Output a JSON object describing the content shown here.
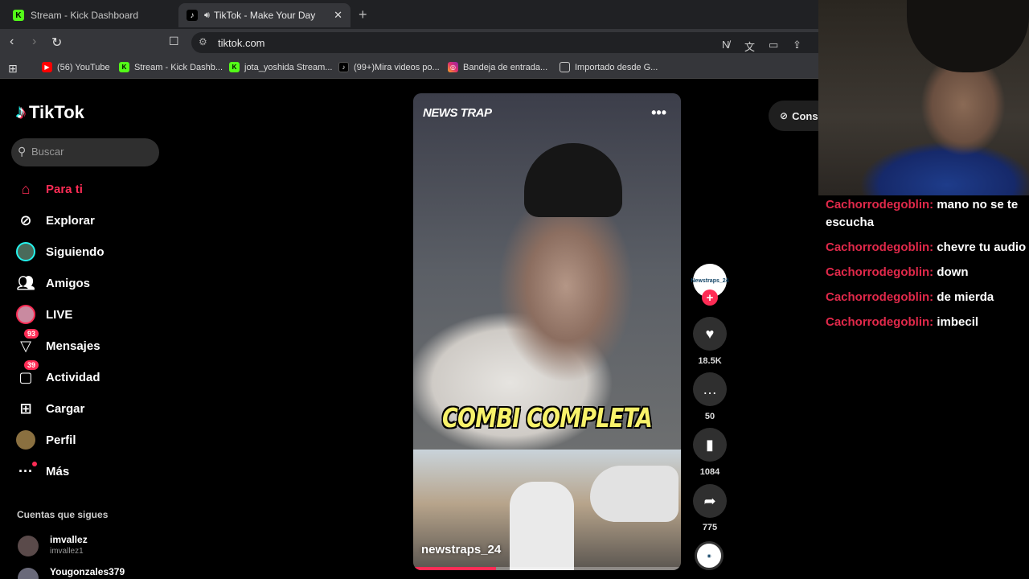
{
  "browser": {
    "tabs": [
      {
        "title": "Stream - Kick Dashboard",
        "icon": "kick-icon"
      },
      {
        "title": "TikTok - Make Your Day",
        "icon": "tiktok-icon"
      }
    ],
    "url": "tiktok.com",
    "bookmarks": [
      {
        "label": "(56) YouTube",
        "icon": "youtube-icon"
      },
      {
        "label": "Stream - Kick Dashb...",
        "icon": "kick-icon"
      },
      {
        "label": "jota_yoshida Stream...",
        "icon": "kick-icon"
      },
      {
        "label": "(99+)Mira videos po...",
        "icon": "tiktok-icon"
      },
      {
        "label": "Bandeja de entrada...",
        "icon": "instagram-icon"
      },
      {
        "label": "Importado desde G...",
        "icon": "folder-icon"
      }
    ]
  },
  "tiktok": {
    "logo_text": "TikTok",
    "search_placeholder": "Buscar",
    "nav": [
      {
        "label": "Para ti",
        "icon": "home-icon",
        "active": true
      },
      {
        "label": "Explorar",
        "icon": "compass-icon"
      },
      {
        "label": "Siguiendo",
        "icon": "following-avatar-icon"
      },
      {
        "label": "Amigos",
        "icon": "friends-icon"
      },
      {
        "label": "LIVE",
        "icon": "live-icon"
      },
      {
        "label": "Mensajes",
        "icon": "messages-icon",
        "badge": "93"
      },
      {
        "label": "Actividad",
        "icon": "activity-icon",
        "badge": "39"
      },
      {
        "label": "Cargar",
        "icon": "upload-icon"
      },
      {
        "label": "Perfil",
        "icon": "profile-icon"
      },
      {
        "label": "Más",
        "icon": "more-icon"
      }
    ],
    "following_header": "Cuentas que sigues",
    "following": [
      {
        "name": "imvallez",
        "handle": "imvallez1"
      },
      {
        "name": "Yougonzales379",
        "handle": ""
      }
    ],
    "get_app_label": "Consigue"
  },
  "video": {
    "brand": "NEWS TRAP",
    "caption": "COMBI COMPLETA",
    "username": "newstraps_24",
    "progress": 0.31,
    "creator_avatar_text": "Newstraps_24",
    "likes": "18.5K",
    "comments": "50",
    "saves": "1084",
    "shares": "775"
  },
  "chat": [
    {
      "user": "Cachorrodegoblin:",
      "message": "mano no se te escucha"
    },
    {
      "user": "Cachorrodegoblin:",
      "message": "chevre tu audio"
    },
    {
      "user": "Cachorrodegoblin:",
      "message": "down"
    },
    {
      "user": "Cachorrodegoblin:",
      "message": "de mierda"
    },
    {
      "user": "Cachorrodegoblin:",
      "message": "imbecil"
    }
  ],
  "colors": {
    "accent": "#fe2c55",
    "chat_user": "#e0294a",
    "kick_green": "#53fc18"
  }
}
